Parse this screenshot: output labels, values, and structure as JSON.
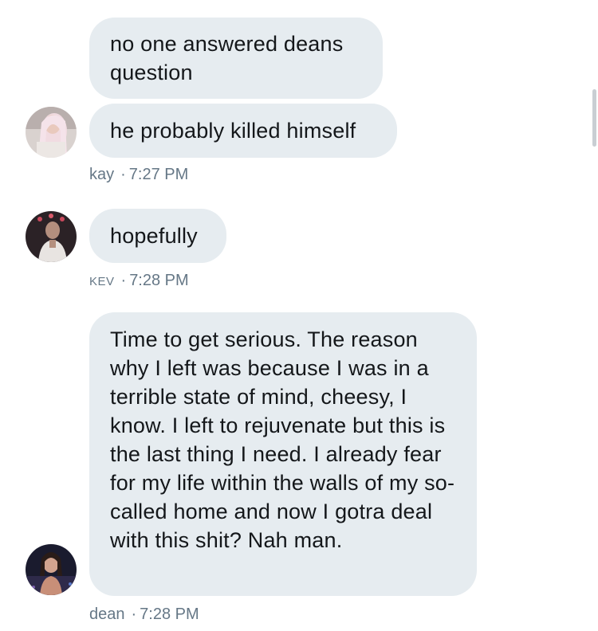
{
  "messages": [
    {
      "sender": "kay",
      "bubbles": [
        "no one answered deans question",
        "he probably killed himself"
      ],
      "time": "7:27 PM"
    },
    {
      "sender": "KEV",
      "bubbles": [
        "hopefully"
      ],
      "time": "7:28 PM"
    },
    {
      "sender": "dean",
      "bubbles": [
        "Time to get serious. The reason why I left was because I was in a terrible state of mind, cheesy, I know. I left to rejuvenate but this is the last thing I need. I already fear for my life within the walls of my so-called home and now I gotra deal with this shit? Nah man."
      ],
      "time": "7:28 PM"
    }
  ],
  "separator": "·",
  "colors": {
    "bubble": "#e6ecf0",
    "meta_text": "#657786",
    "message_text": "#14171a"
  }
}
